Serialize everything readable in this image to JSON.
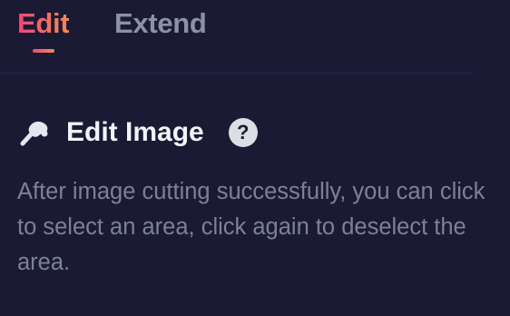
{
  "tabs": [
    {
      "label": "Edit",
      "active": true
    },
    {
      "label": "Extend",
      "active": false
    }
  ],
  "section": {
    "icon": "edit-hand-icon",
    "title": "Edit Image",
    "help_symbol": "?",
    "description": "After image cutting successfully, you can click to select an area, click again to deselect the area."
  },
  "colors": {
    "background": "#1a1a35",
    "accent_start": "#f0467d",
    "accent_end": "#f58a4f",
    "inactive_tab": "#8d91a5",
    "title": "#f2f2f7",
    "body_text": "#7d8198"
  }
}
